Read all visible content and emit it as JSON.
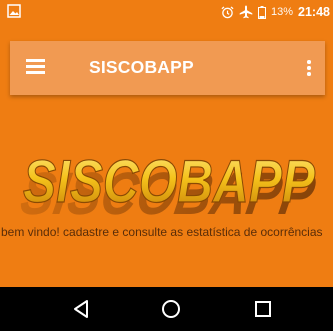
{
  "status_bar": {
    "battery_percent": "13%",
    "time": "21:48",
    "icons": [
      "gallery-icon",
      "alarm-icon",
      "airplane-icon",
      "battery-icon"
    ]
  },
  "app_bar": {
    "title": "SISCOBAPP",
    "menu_icon": "menu-icon",
    "overflow_icon": "more-vert-icon"
  },
  "main": {
    "logo_text": "SISCOBAPP",
    "welcome_text": "bem vindo! cadastre e consulte as estatística de ocorrências"
  },
  "nav_bar": {
    "buttons": [
      "back-icon",
      "home-icon",
      "recents-icon"
    ]
  },
  "colors": {
    "background": "#ef7d12",
    "app_bar": "#f19a52",
    "logo_gold": "#f5c21b",
    "nav_bar": "#000000"
  }
}
